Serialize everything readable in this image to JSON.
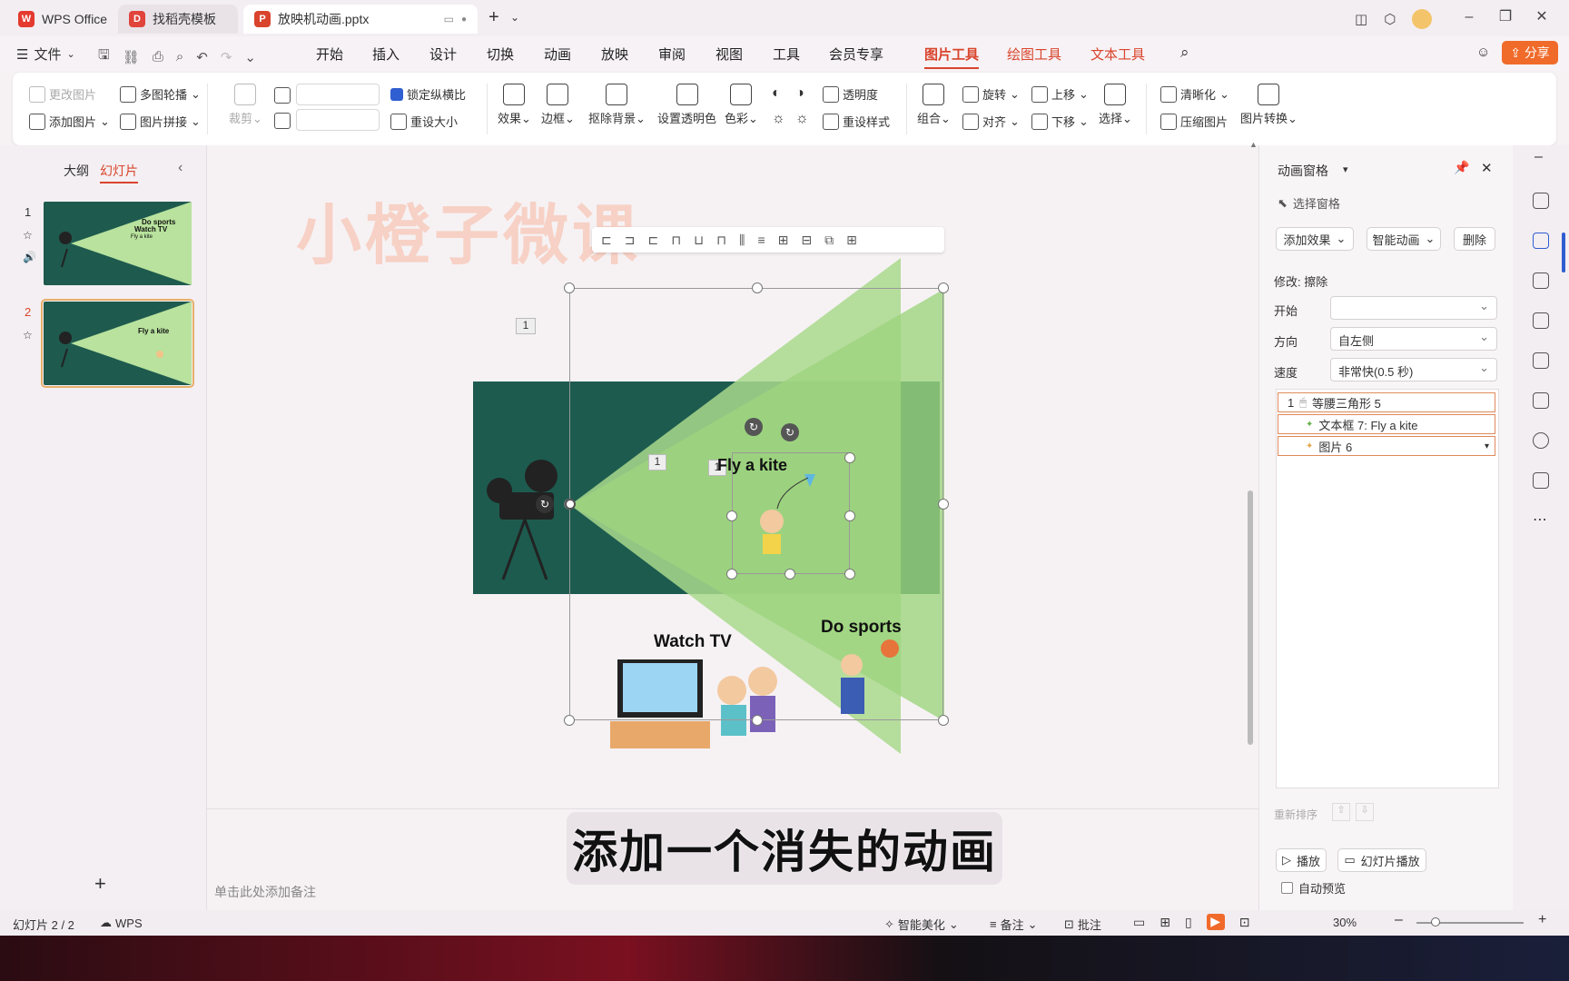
{
  "tabs": [
    {
      "label": "WPS Office"
    },
    {
      "label": "找稻壳模板"
    },
    {
      "label": "放映机动画.pptx"
    }
  ],
  "menu": {
    "file": "文件",
    "items": [
      "开始",
      "插入",
      "设计",
      "切换",
      "动画",
      "放映",
      "审阅",
      "视图",
      "工具",
      "会员专享"
    ],
    "context_tabs": [
      "图片工具",
      "绘图工具",
      "文本工具"
    ],
    "share": "分享"
  },
  "ribbon": {
    "change_picture": "更改图片",
    "multi_outline": "多图轮播",
    "add_picture": "添加图片",
    "picture_collage": "图片拼接",
    "crop": "裁剪",
    "lock_ratio": "锁定纵横比",
    "reset_size": "重设大小",
    "effect": "效果",
    "border": "边框",
    "remove_bg": "抠除背景",
    "set_transparent": "设置透明色",
    "color": "色彩",
    "transparency": "透明度",
    "reset_style": "重设样式",
    "combine": "组合",
    "rotate": "旋转",
    "align": "对齐",
    "bring_forward": "上移",
    "send_backward": "下移",
    "select": "选择",
    "sharpen": "清晰化",
    "compress": "压缩图片",
    "convert": "图片转换"
  },
  "left_panel": {
    "outline_tab": "大纲",
    "slides_tab": "幻灯片",
    "slides": [
      {
        "number": "1",
        "texts": [
          "Do sports",
          "Watch TV",
          "Fly a kite"
        ]
      },
      {
        "number": "2",
        "texts": [
          "Fly a kite"
        ]
      }
    ],
    "add_slide": "+"
  },
  "canvas": {
    "watermark": "小橙子微课",
    "anim_tag": "1",
    "anim_tag_2": "1",
    "anim_tag_3": "1",
    "slide_title": "Fly a kite",
    "watch_tv": "Watch TV",
    "do_sports": "Do sports",
    "notes_placeholder": "单击此处添加备注",
    "subtitle": "添加一个消失的动画"
  },
  "anim_pane": {
    "title": "动画窗格",
    "select_pane": "选择窗格",
    "add_effect": "添加效果",
    "smart_anim": "智能动画",
    "delete": "删除",
    "modify_label": "修改: 擦除",
    "start_label": "开始",
    "start_value": "",
    "direction_label": "方向",
    "direction_value": "自左侧",
    "speed_label": "速度",
    "speed_value": "非常快(0.5 秒)",
    "items": [
      {
        "index": "1",
        "name": "等腰三角形 5"
      },
      {
        "index": "",
        "name": "文本框 7: Fly a kite"
      },
      {
        "index": "",
        "name": "图片 6"
      }
    ],
    "reorder": "重新排序",
    "play": "播放",
    "slideshow": "幻灯片播放",
    "auto_preview": "自动预览"
  },
  "status": {
    "slide_count": "幻灯片 2 / 2",
    "app": "WPS",
    "beautify": "智能美化",
    "notes": "备注",
    "comments": "批注",
    "zoom": "30%"
  },
  "colors": {
    "slide_bg": "#1d5b4f",
    "beam": "#a8d88a",
    "accent": "#f06a2a",
    "context_tab": "#d9442c"
  }
}
